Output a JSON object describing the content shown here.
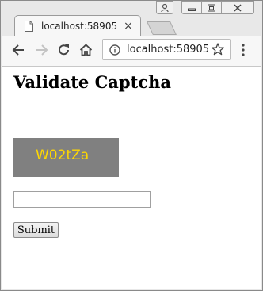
{
  "browser": {
    "tab_title": "localhost:58905",
    "tab_close_glyph": "×",
    "url": "localhost:58905"
  },
  "icons": {
    "profile": "profile-icon",
    "minimize": "minimize-icon",
    "maximize": "maximize-icon",
    "close": "close-icon",
    "page": "page-icon",
    "back": "back-arrow-icon",
    "forward": "forward-arrow-icon",
    "reload": "reload-icon",
    "home": "home-icon",
    "info": "info-icon",
    "star": "star-icon",
    "menu": "menu-icon"
  },
  "page": {
    "title": "Validate Captcha",
    "captcha_text": "W02tZa",
    "captcha_bg": "#808080",
    "captcha_color": "#ffd800",
    "input_value": "",
    "submit_label": "Submit"
  }
}
